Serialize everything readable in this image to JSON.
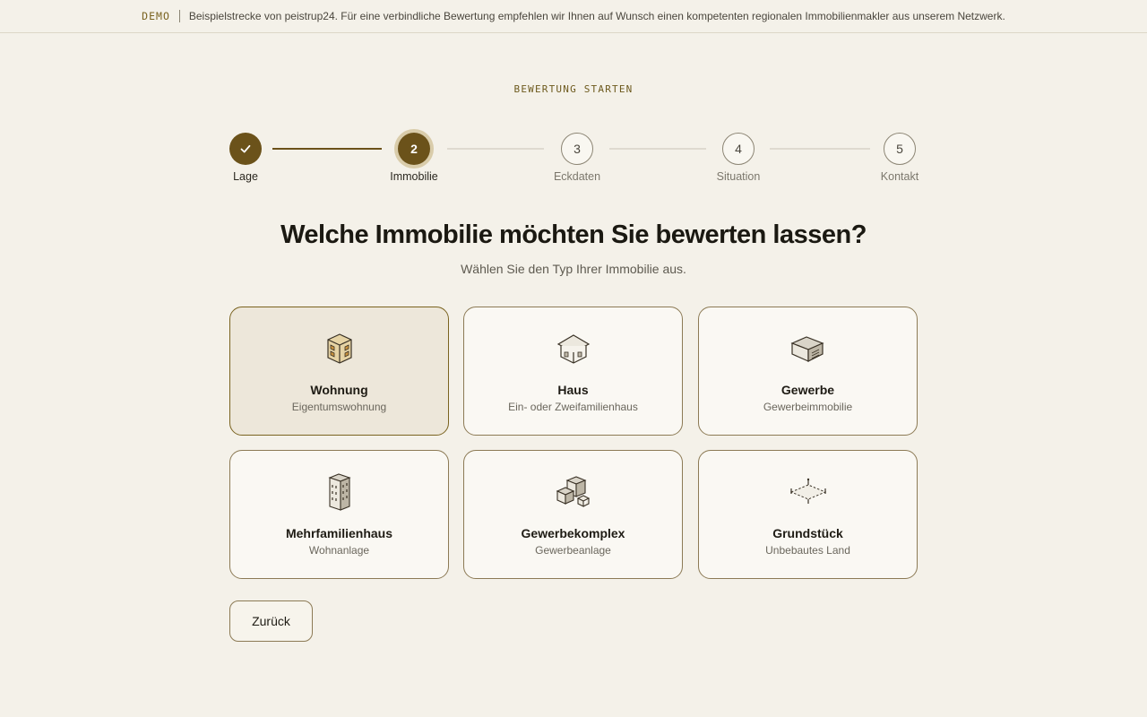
{
  "banner": {
    "tag": "DEMO",
    "text": "Beispielstrecke von peistrup24. Für eine verbindliche Bewertung empfehlen wir Ihnen auf Wunsch einen kompetenten regionalen Immobilienmakler aus unserem Netzwerk."
  },
  "eyebrow": "BEWERTUNG STARTEN",
  "stepper": {
    "steps": [
      {
        "number": "",
        "label": "Lage",
        "state": "done",
        "icon": "check-icon"
      },
      {
        "number": "2",
        "label": "Immobilie",
        "state": "active"
      },
      {
        "number": "3",
        "label": "Eckdaten",
        "state": "todo"
      },
      {
        "number": "4",
        "label": "Situation",
        "state": "todo"
      },
      {
        "number": "5",
        "label": "Kontakt",
        "state": "todo"
      }
    ]
  },
  "title": "Welche Immobilie möchten Sie bewerten lassen?",
  "subtitle": "Wählen Sie den Typ Ihrer Immobilie aus.",
  "options": [
    {
      "name": "Wohnung",
      "desc": "Eigentumswohnung",
      "icon": "apartment-icon",
      "selected": true
    },
    {
      "name": "Haus",
      "desc": "Ein- oder Zweifamilienhaus",
      "icon": "house-icon",
      "selected": false
    },
    {
      "name": "Gewerbe",
      "desc": "Gewerbeimmobilie",
      "icon": "commercial-icon",
      "selected": false
    },
    {
      "name": "Mehrfamilienhaus",
      "desc": "Wohnanlage",
      "icon": "multi-family-icon",
      "selected": false
    },
    {
      "name": "Gewerbekomplex",
      "desc": "Gewerbeanlage",
      "icon": "commercial-complex-icon",
      "selected": false
    },
    {
      "name": "Grundstück",
      "desc": "Unbebautes Land",
      "icon": "land-plot-icon",
      "selected": false
    }
  ],
  "back_button": "Zurück",
  "colors": {
    "accent": "#6b521a",
    "background": "#f4f1e9",
    "card": "#faf8f3",
    "card_selected": "#ede7da"
  }
}
